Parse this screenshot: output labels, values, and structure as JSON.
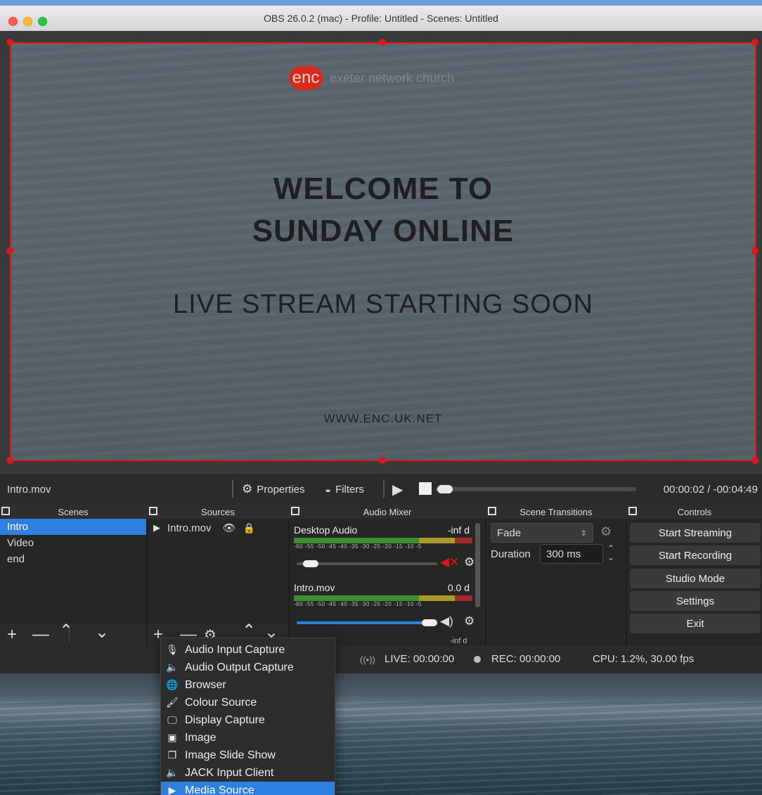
{
  "window": {
    "title": "OBS 26.0.2 (mac) - Profile: Untitled - Scenes: Untitled"
  },
  "preview": {
    "logo_mark": "enc",
    "logo_text": "exeter network church",
    "line1": "WELCOME  TO",
    "line2": "SUNDAY ONLINE",
    "line3": "LIVE STREAM STARTING SOON",
    "line4": "WWW.ENC.UK.NET"
  },
  "media_toolbar": {
    "source_name": "Intro.mov",
    "properties_label": "Properties",
    "filters_label": "Filters",
    "time": "00:00:02 / -00:04:49",
    "progress": 0.007
  },
  "docks": {
    "scenes": {
      "title": "Scenes",
      "items": [
        "Intro",
        "Video",
        "end"
      ],
      "selected": "Intro"
    },
    "sources": {
      "title": "Sources",
      "items": [
        {
          "name": "Intro.mov"
        }
      ]
    },
    "audio_mixer": {
      "title": "Audio Mixer",
      "channels": [
        {
          "name": "Desktop Audio",
          "level": "-inf d",
          "muted": true,
          "volume": 0.05
        },
        {
          "name": "Intro.mov",
          "level": "0.0 d",
          "muted": false,
          "volume": 1.0
        }
      ],
      "third_channel_level": "-inf d",
      "tick_labels": "-60 -55 -50 -45 -40 -35 -30 -25 -20 -15 -10 -5"
    },
    "scene_transitions": {
      "title": "Scene Transitions",
      "transition": "Fade",
      "duration_label": "Duration",
      "duration_value": "300 ms"
    },
    "controls": {
      "title": "Controls",
      "buttons": [
        "Start Streaming",
        "Start Recording",
        "Studio Mode",
        "Settings",
        "Exit"
      ]
    }
  },
  "status_bar": {
    "live": "LIVE: 00:00:00",
    "rec": "REC: 00:00:00",
    "cpu": "CPU: 1.2%, 30.00 fps"
  },
  "add_source_menu": {
    "items": [
      {
        "label": "Audio Input Capture",
        "icon": "microphone-icon"
      },
      {
        "label": "Audio Output Capture",
        "icon": "speaker-icon"
      },
      {
        "label": "Browser",
        "icon": "globe-icon"
      },
      {
        "label": "Colour Source",
        "icon": "brush-icon"
      },
      {
        "label": "Display Capture",
        "icon": "monitor-icon"
      },
      {
        "label": "Image",
        "icon": "image-icon"
      },
      {
        "label": "Image Slide Show",
        "icon": "slideshow-icon"
      },
      {
        "label": "JACK Input Client",
        "icon": "speaker-icon"
      },
      {
        "label": "Media Source",
        "icon": "play-icon"
      }
    ],
    "selected": "Media Source"
  },
  "colors": {
    "accent": "#2d7fe0",
    "selection_border": "#e0161b",
    "mute": "#e0161b"
  }
}
